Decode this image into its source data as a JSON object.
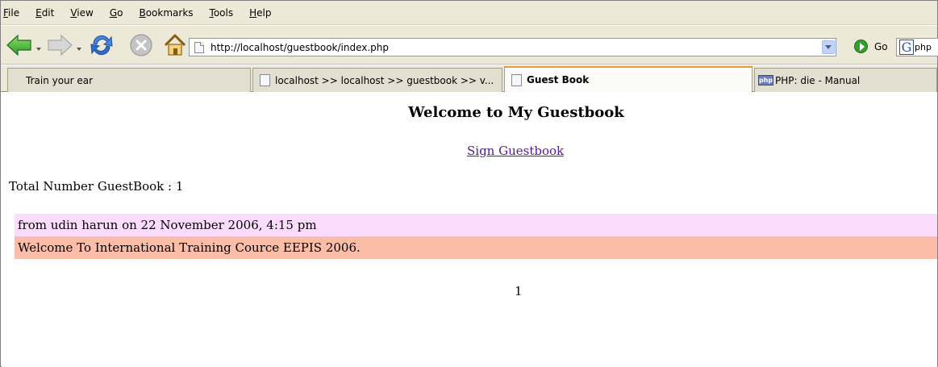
{
  "menu": {
    "items": [
      "File",
      "Edit",
      "View",
      "Go",
      "Bookmarks",
      "Tools",
      "Help"
    ]
  },
  "toolbar": {
    "url": "http://localhost/guestbook/index.php",
    "go_label": "Go",
    "search_text": "php",
    "icons": [
      "back-arrow-icon",
      "forward-arrow-icon",
      "reload-icon",
      "stop-icon",
      "home-icon",
      "go-icon",
      "google-search-icon"
    ],
    "colors": {
      "back": "#2e9c2e",
      "reload": "#2f6dd1",
      "stop": "#b7b7b7",
      "go": "#34a02c"
    }
  },
  "tabs": [
    {
      "label": "Train your ear",
      "active": false
    },
    {
      "label": "localhost >> localhost >> guestbook >> v...",
      "active": false
    },
    {
      "label": "Guest Book",
      "active": true
    },
    {
      "label": "PHP: die - Manual",
      "active": false,
      "favicon": "php"
    }
  ],
  "page": {
    "title": "Welcome to My Guestbook",
    "sign_link": "Sign Guestbook",
    "total": "Total Number GuestBook : 1",
    "entries": [
      {
        "header": "from udin harun on 22 November 2006, 4:15 pm",
        "message": "Welcome To International Training Cource EEPIS 2006."
      }
    ],
    "pages": [
      "1"
    ],
    "colors": {
      "entry_header_bg": "#fcdcfc",
      "entry_body_bg": "#fbbda8",
      "link": "#551a8b"
    }
  }
}
